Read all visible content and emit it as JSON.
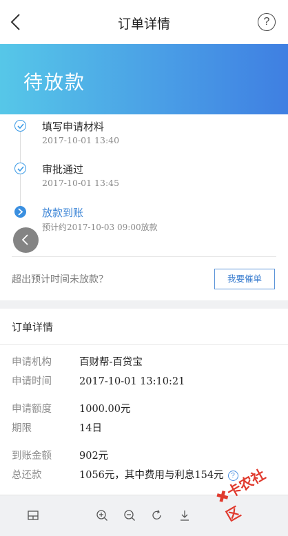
{
  "nav": {
    "title": "订单详情",
    "help_glyph": "?"
  },
  "banner": {
    "status": "待放款"
  },
  "steps": [
    {
      "name": "填写申请材料",
      "time": "2017-10-01 13:40",
      "state": "done"
    },
    {
      "name": "审批通过",
      "time": "2017-10-01 13:45",
      "state": "done"
    },
    {
      "name": "放款到账",
      "time": "预计约2017-10-03 09:00放款",
      "state": "current"
    }
  ],
  "overdue": {
    "text": "超出预计时间未放款？",
    "urge_label": "我要催单"
  },
  "details": {
    "heading": "订单详情",
    "rows": [
      {
        "label": "申请机构",
        "value": "百财帮-百贷宝"
      },
      {
        "label": "申请时间",
        "value": "2017-10-01 13:10:21"
      },
      {
        "label": "申请额度",
        "value": "1000.00元"
      },
      {
        "label": "期限",
        "value": "14日"
      },
      {
        "label": "到账金额",
        "value": "902元"
      },
      {
        "label": "总还款",
        "value": "1056元，其中费用与利息154元"
      }
    ]
  },
  "watermark": {
    "text": "卡农社区"
  },
  "colors": {
    "accent": "#3a8fe0",
    "banner_start": "#56c7e8",
    "banner_end": "#3f7fe2",
    "watermark": "#e03a2e"
  }
}
